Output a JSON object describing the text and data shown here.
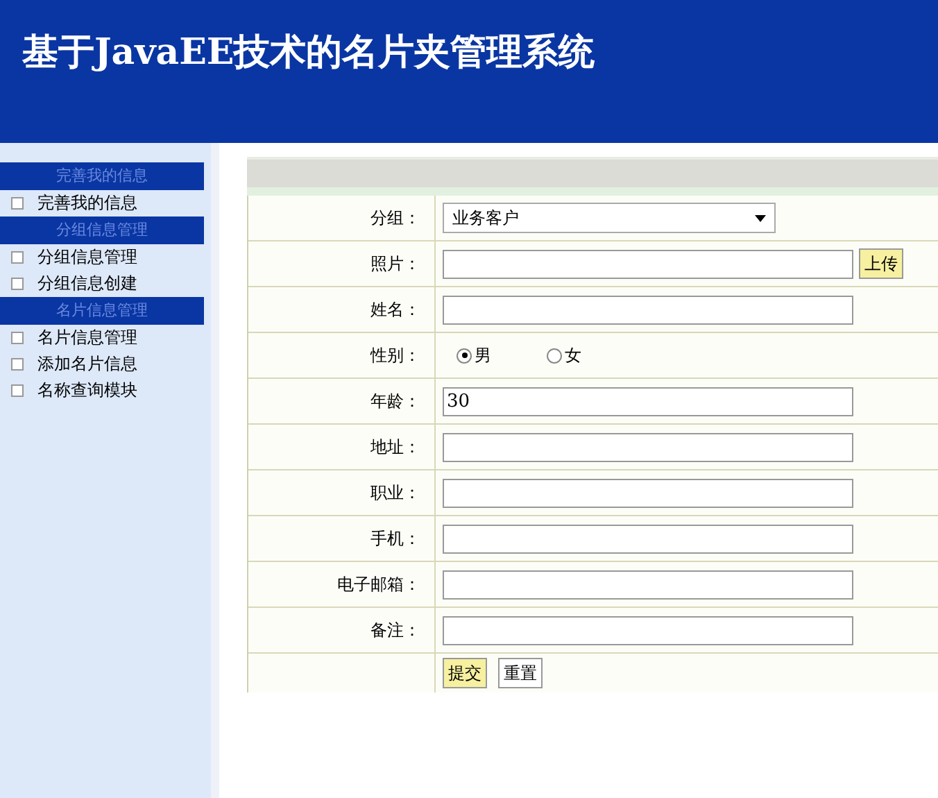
{
  "header": {
    "title": "基于JavaEE技术的名片夹管理系统"
  },
  "sidebar": {
    "sections": [
      {
        "heading": "完善我的信息",
        "items": [
          {
            "label": "完善我的信息"
          }
        ]
      },
      {
        "heading": "分组信息管理",
        "items": [
          {
            "label": "分组信息管理"
          },
          {
            "label": "分组信息创建"
          }
        ]
      },
      {
        "heading": "名片信息管理",
        "items": [
          {
            "label": "名片信息管理"
          },
          {
            "label": "添加名片信息"
          },
          {
            "label": "名称查询模块"
          }
        ]
      }
    ]
  },
  "form": {
    "rows": [
      {
        "kind": "select",
        "label": "分组：",
        "value": "业务客户"
      },
      {
        "kind": "upload",
        "label": "照片：",
        "button": "上传"
      },
      {
        "kind": "text",
        "label": "姓名："
      },
      {
        "kind": "radio",
        "label": "性别：",
        "options": [
          {
            "label": "男",
            "selected": true
          },
          {
            "label": "女",
            "selected": false
          }
        ]
      },
      {
        "kind": "text",
        "label": "年龄：",
        "value": "30"
      },
      {
        "kind": "text",
        "label": "地址："
      },
      {
        "kind": "text",
        "label": "职业："
      },
      {
        "kind": "text",
        "label": "手机："
      },
      {
        "kind": "text",
        "label": "电子邮箱："
      },
      {
        "kind": "text",
        "label": "备注："
      }
    ],
    "buttons": [
      {
        "label": "提交",
        "primary": true
      },
      {
        "label": "重置",
        "primary": false
      }
    ]
  }
}
